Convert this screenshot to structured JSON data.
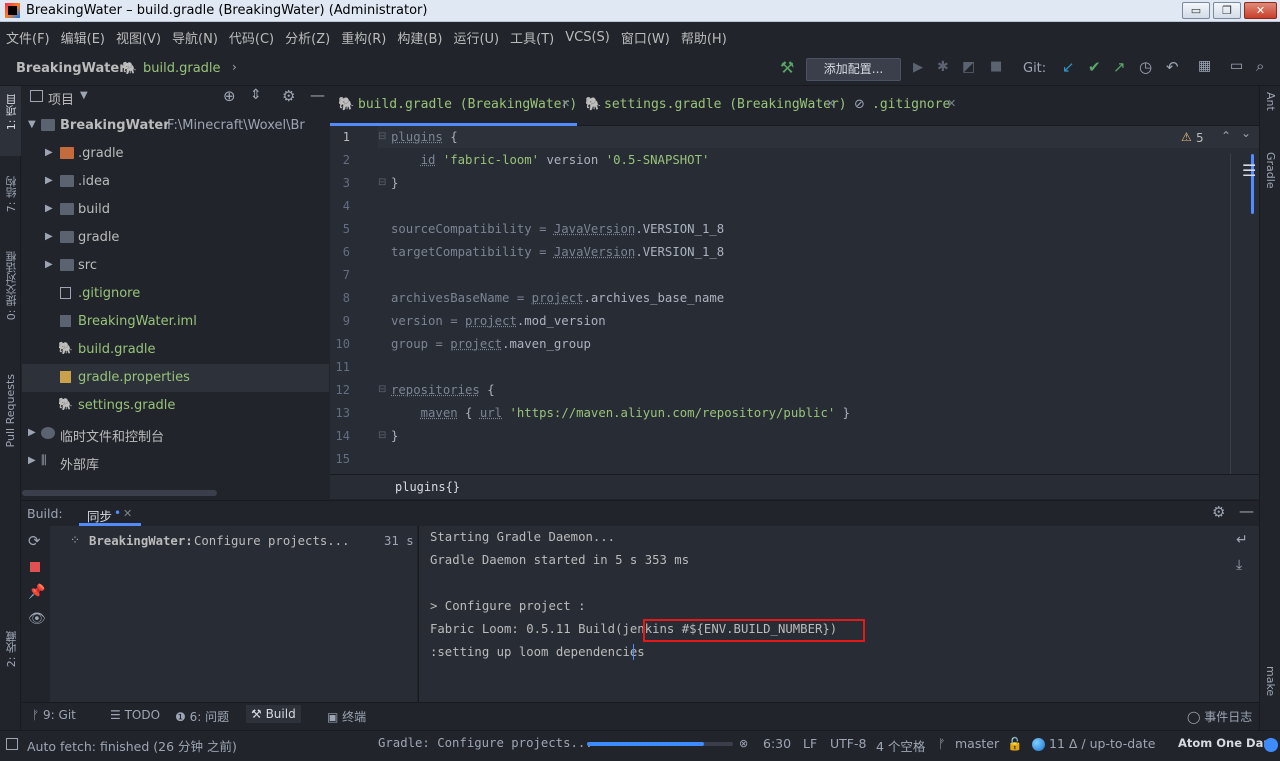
{
  "window": {
    "title": "BreakingWater – build.gradle (BreakingWater) (Administrator)",
    "buttons": {
      "minimize": "▭",
      "restore": "❐",
      "close": "✕"
    }
  },
  "menu": [
    "文件(F)",
    "编辑(E)",
    "视图(V)",
    "导航(N)",
    "代码(C)",
    "分析(Z)",
    "重构(R)",
    "构建(B)",
    "运行(U)",
    "工具(T)",
    "VCS(S)",
    "窗口(W)",
    "帮助(H)"
  ],
  "nav": {
    "project": "BreakingWater",
    "file": "build.gradle",
    "add_config": "添加配置...",
    "git_label": "Git:"
  },
  "left_strip": [
    "1: 项目",
    "7: 结构",
    "0: 提交对话框",
    "Pull Requests",
    "2: 收藏"
  ],
  "right_strip": [
    "Ant",
    "Gradle",
    "make"
  ],
  "project_panel": {
    "title": "项目",
    "tree": [
      {
        "label": "BreakingWater",
        "extra": "F:\\Minecraft\\Woxel\\Br"
      },
      {
        "label": ".gradle"
      },
      {
        "label": ".idea"
      },
      {
        "label": "build"
      },
      {
        "label": "gradle"
      },
      {
        "label": "src"
      },
      {
        "label": ".gitignore"
      },
      {
        "label": "BreakingWater.iml"
      },
      {
        "label": "build.gradle"
      },
      {
        "label": "gradle.properties"
      },
      {
        "label": "settings.gradle"
      },
      {
        "label": "临时文件和控制台"
      },
      {
        "label": "外部库"
      }
    ]
  },
  "tabs": [
    {
      "label": "build.gradle (BreakingWater)",
      "close": "✕"
    },
    {
      "label": "settings.gradle (BreakingWater)",
      "close": "✕"
    },
    {
      "label": ".gitignore",
      "close": "✕"
    }
  ],
  "editor": {
    "warnings": "5",
    "lines": [
      "1",
      "2",
      "3",
      "4",
      "5",
      "6",
      "7",
      "8",
      "9",
      "10",
      "11",
      "12",
      "13",
      "14",
      "15"
    ],
    "code": {
      "l1a": "plugins",
      "l1b": " {",
      "l2a": "    ",
      "l2b": "id",
      "l2c": " ",
      "l2d": "'fabric-loom'",
      "l2e": " version ",
      "l2f": "'0.5-SNAPSHOT'",
      "l3": "}",
      "l5a": "sourceCompatibility = ",
      "l5b": "JavaVersion",
      "l5c": ".VERSION_1_8",
      "l6a": "targetCompatibility = ",
      "l6b": "JavaVersion",
      "l6c": ".VERSION_1_8",
      "l8a": "archivesBaseName = ",
      "l8b": "project",
      "l8c": ".archives_base_name",
      "l9a": "version = ",
      "l9b": "project",
      "l9c": ".mod_version",
      "l10a": "group = ",
      "l10b": "project",
      "l10c": ".maven_group",
      "l12a": "repositories",
      "l12b": " {",
      "l13a": "    ",
      "l13b": "maven",
      "l13c": " { ",
      "l13d": "url",
      "l13e": " ",
      "l13f": "'https://maven.aliyun.com/repository/public'",
      "l13g": " }",
      "l14": "}"
    },
    "breadcrumb": "plugins{}"
  },
  "build": {
    "label": "Build:",
    "tab": "同步",
    "tab_close": "✕",
    "task_name": "BreakingWater:",
    "task_desc": "Configure projects...",
    "task_time": "31 s",
    "output": [
      "Starting Gradle Daemon...",
      "Gradle Daemon started in 5 s 353 ms",
      "",
      "> Configure project :",
      "Fabric Loom: 0.5.11 Build(jenkins #${ENV.BUILD_NUMBER})",
      ":setting up loom dependencies"
    ]
  },
  "tool_windows": [
    {
      "num": "9",
      "label": "Git"
    },
    {
      "num": "",
      "label": "TODO"
    },
    {
      "num": "6",
      "label": "问题"
    },
    {
      "num": "",
      "label": "Build"
    },
    {
      "num": "",
      "label": "终端"
    }
  ],
  "event_log": "事件日志",
  "status": {
    "left": "Auto fetch: finished (26 分钟 之前)",
    "task": "Gradle: Configure projects...",
    "progress": 0.8,
    "position": "6:30",
    "line_sep": "LF",
    "encoding": "UTF-8",
    "indent": "4 个空格",
    "branch": "master",
    "commits": "11 Δ / up-to-date",
    "theme": "Atom One Dark"
  },
  "colors": {
    "accent": "#528bff",
    "highlight_box": "#e51919",
    "toolbar_green": "#59a869",
    "toolbar_blue": "#3592c4"
  }
}
